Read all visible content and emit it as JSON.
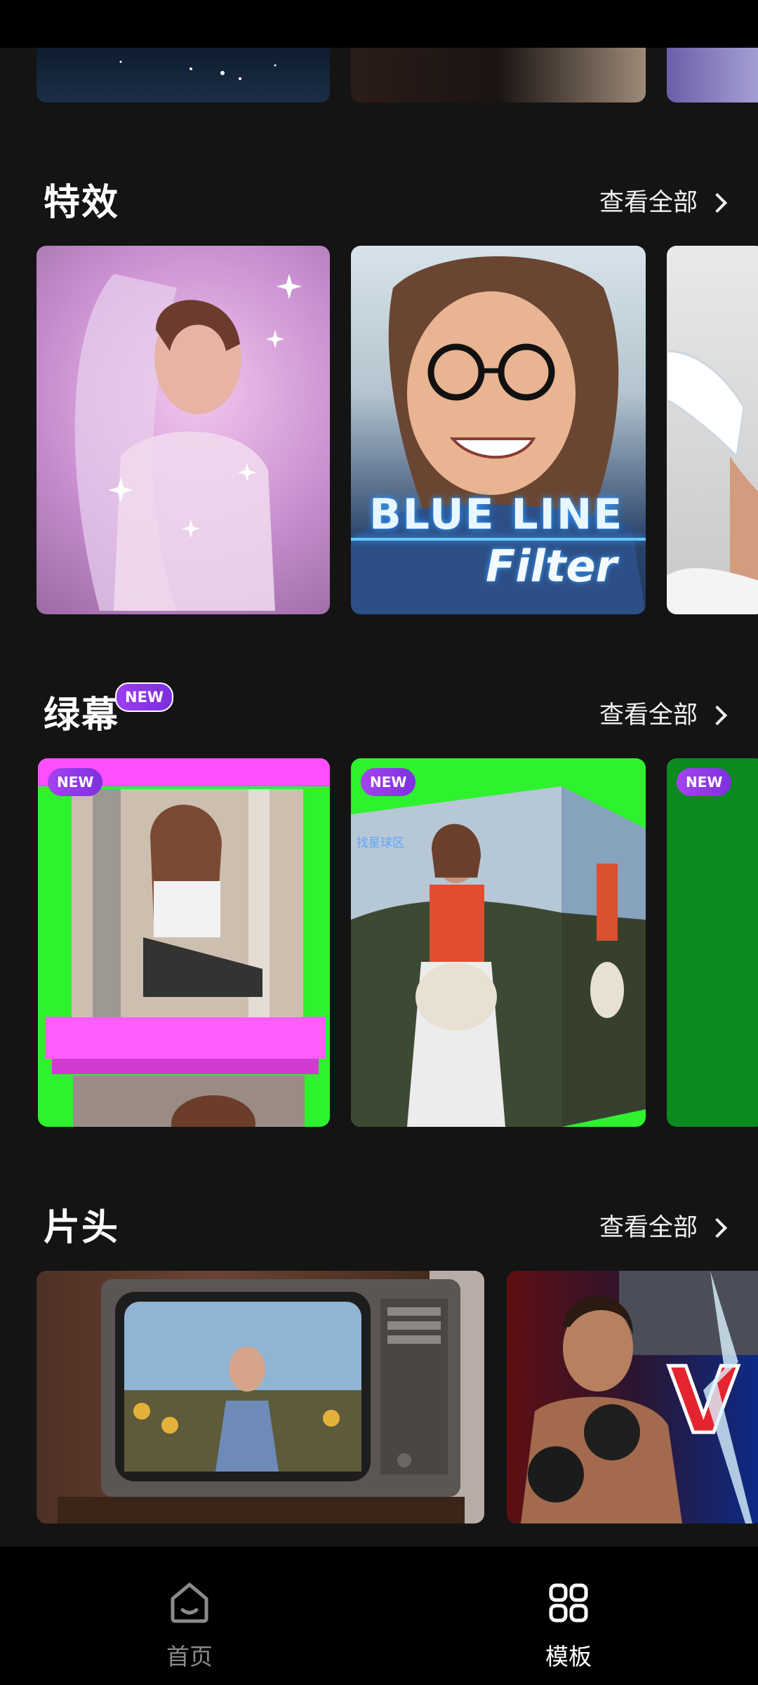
{
  "sections": [
    {
      "title": "特效",
      "view_all": "查看全部"
    },
    {
      "title": "绿幕",
      "new_badge": "NEW",
      "view_all": "查看全部"
    },
    {
      "title": "片头",
      "view_all": "查看全部"
    }
  ],
  "greenscreen_cards": {
    "badge": "NEW",
    "card2_watermark": "找星球区"
  },
  "effect_card2": {
    "line1": "BLUE LINE",
    "line2": "Filter"
  },
  "tabbar": {
    "tabs": [
      {
        "label": "首页",
        "icon": "home-icon",
        "active": false
      },
      {
        "label": "模板",
        "icon": "template-grid-icon",
        "active": true
      }
    ]
  },
  "colors": {
    "background": "#141414",
    "tabbar": "#000000",
    "badge": "#8a37e8",
    "text_inactive": "#8a8a8a"
  }
}
